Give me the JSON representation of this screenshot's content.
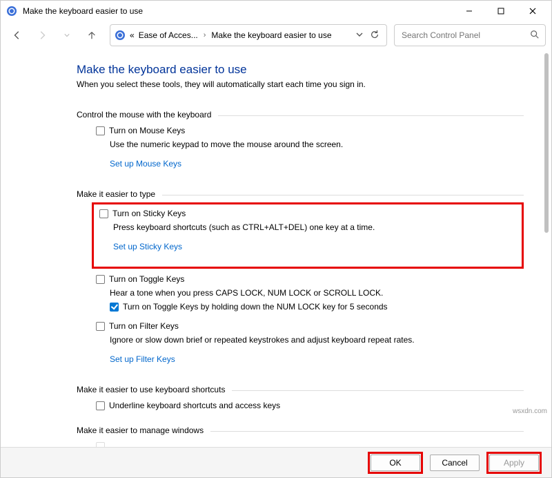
{
  "window": {
    "title": "Make the keyboard easier to use"
  },
  "breadcrumb": {
    "prefix": "«",
    "part1": "Ease of Acces...",
    "part2": "Make the keyboard easier to use"
  },
  "search": {
    "placeholder": "Search Control Panel"
  },
  "page": {
    "heading": "Make the keyboard easier to use",
    "subtitle": "When you select these tools, they will automatically start each time you sign in."
  },
  "sections": {
    "mouse": {
      "title": "Control the mouse with the keyboard",
      "opt_label": "Turn on Mouse Keys",
      "desc": "Use the numeric keypad to move the mouse around the screen.",
      "link": "Set up Mouse Keys"
    },
    "type": {
      "title": "Make it easier to type",
      "sticky_label": "Turn on Sticky Keys",
      "sticky_desc": "Press keyboard shortcuts (such as CTRL+ALT+DEL) one key at a time.",
      "sticky_link": "Set up Sticky Keys",
      "toggle_label": "Turn on Toggle Keys",
      "toggle_desc": "Hear a tone when you press CAPS LOCK, NUM LOCK or SCROLL LOCK.",
      "toggle_sub_label": "Turn on Toggle Keys by holding down the NUM LOCK key for 5 seconds",
      "filter_label": "Turn on Filter Keys",
      "filter_desc": "Ignore or slow down brief or repeated keystrokes and adjust keyboard repeat rates.",
      "filter_link": "Set up Filter Keys"
    },
    "shortcuts": {
      "title": "Make it easier to use keyboard shortcuts",
      "underline_label": "Underline keyboard shortcuts and access keys"
    },
    "windows": {
      "title": "Make it easier to manage windows"
    }
  },
  "buttons": {
    "ok": "OK",
    "cancel": "Cancel",
    "apply": "Apply"
  },
  "watermark": "wsxdn.com"
}
